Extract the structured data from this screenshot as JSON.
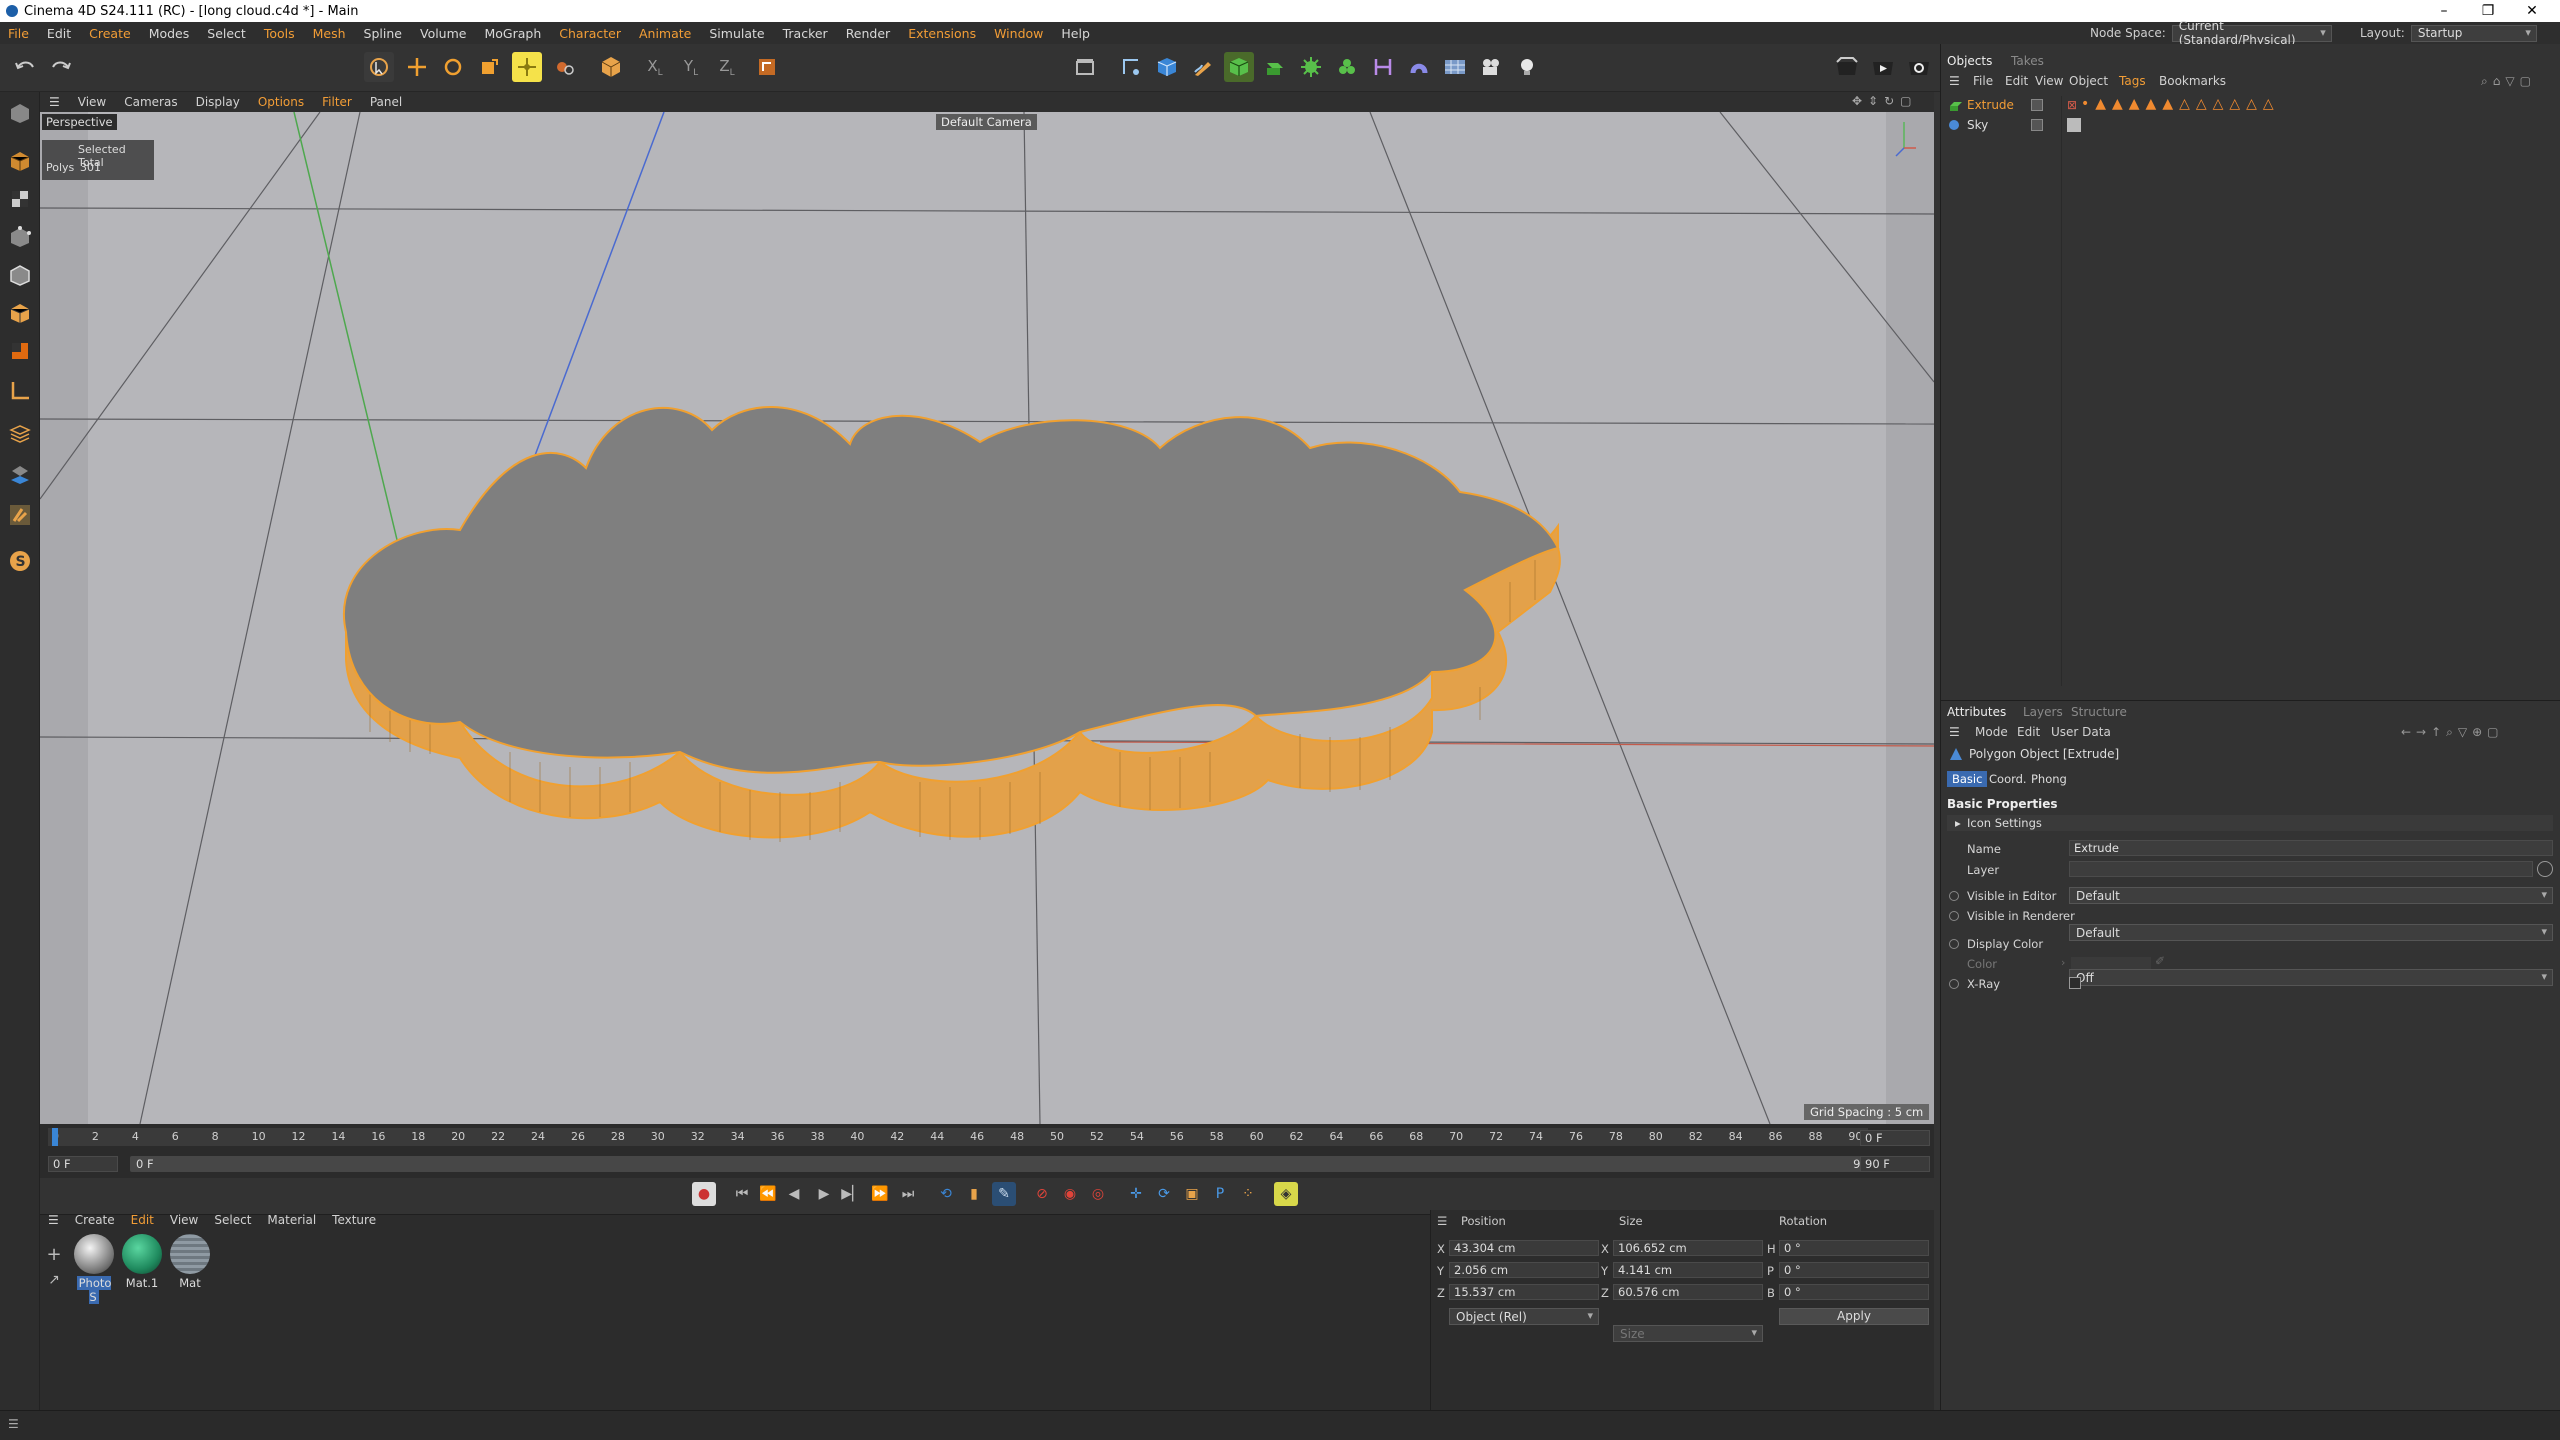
{
  "window": {
    "title": "Cinema 4D S24.111 (RC) - [long cloud.c4d *] - Main",
    "minimize": "–",
    "maximize": "❐",
    "close": "✕"
  },
  "menubar": {
    "items": [
      "File",
      "Edit",
      "Create",
      "Modes",
      "Select",
      "Tools",
      "Mesh",
      "Spline",
      "Volume",
      "MoGraph",
      "Character",
      "Animate",
      "Simulate",
      "Tracker",
      "Render",
      "Extensions",
      "Window",
      "Help"
    ],
    "highlighted": [
      "Character",
      "Animate",
      "Extensions"
    ],
    "node_space_label": "Node Space:",
    "node_space_value": "Current (Standard/Physical)",
    "layout_label": "Layout:",
    "layout_value": "Startup"
  },
  "viewport": {
    "menu": [
      "View",
      "Cameras",
      "Display",
      "Options",
      "Filter",
      "Panel"
    ],
    "menu_highlighted": "Options",
    "view_name": "Perspective",
    "camera": "Default Camera",
    "hud_header": "Selected Total",
    "hud_polys_label": "Polys",
    "hud_polys_value": "301",
    "grid_spacing": "Grid Spacing : 5 cm"
  },
  "timeline": {
    "ticks": [
      "0",
      "2",
      "4",
      "6",
      "8",
      "10",
      "12",
      "14",
      "16",
      "18",
      "20",
      "22",
      "24",
      "26",
      "28",
      "30",
      "32",
      "34",
      "36",
      "38",
      "40",
      "42",
      "44",
      "46",
      "48",
      "50",
      "52",
      "54",
      "56",
      "58",
      "60",
      "62",
      "64",
      "66",
      "68",
      "70",
      "72",
      "74",
      "76",
      "78",
      "80",
      "82",
      "84",
      "86",
      "88",
      "90"
    ],
    "current_frame": "0 F",
    "start_field": "0 F",
    "range_start": "0 F",
    "range_end": "90 F",
    "end_field": "90 F"
  },
  "materials": {
    "menu": [
      "Create",
      "Edit",
      "View",
      "Select",
      "Material",
      "Texture"
    ],
    "menu_highlighted": "Edit",
    "items": [
      {
        "name": "Photo S",
        "color": "#d0d0d0"
      },
      {
        "name": "Mat.1",
        "color": "#1f8a5e"
      },
      {
        "name": "Mat",
        "color": "#8f9aa3"
      }
    ]
  },
  "coordinates": {
    "headers": {
      "position": "Position",
      "size": "Size",
      "rotation": "Rotation"
    },
    "pos": {
      "x": "43.304 cm",
      "y": "2.056 cm",
      "z": "15.537 cm"
    },
    "size": {
      "x": "106.652 cm",
      "y": "4.141 cm",
      "z": "60.576 cm"
    },
    "rot": {
      "h": "0 °",
      "p": "0 °",
      "b": "0 °"
    },
    "axes_pos": [
      "X",
      "Y",
      "Z"
    ],
    "axes_size": [
      "X",
      "Y",
      "Z"
    ],
    "axes_rot": [
      "H",
      "P",
      "B"
    ],
    "mode": "Object (Rel)",
    "size_mode": "Size",
    "apply": "Apply"
  },
  "objects": {
    "tabs": [
      "Objects",
      "Takes"
    ],
    "menu": [
      "File",
      "Edit",
      "View",
      "Object",
      "Tags",
      "Bookmarks"
    ],
    "menu_highlighted": "Tags",
    "rows": [
      {
        "name": "Extrude",
        "selected": true
      },
      {
        "name": "Sky",
        "selected": false
      }
    ]
  },
  "attributes": {
    "tabs": [
      "Attributes",
      "Layers",
      "Structure"
    ],
    "menu": [
      "Mode",
      "Edit",
      "User Data"
    ],
    "object_title": "Polygon Object [Extrude]",
    "subtabs": [
      "Basic",
      "Coord.",
      "Phong"
    ],
    "section": "Basic Properties",
    "icon_settings": "Icon Settings",
    "name_label": "Name",
    "name_value": "Extrude",
    "layer_label": "Layer",
    "layer_value": "",
    "visible_editor_label": "Visible in Editor",
    "visible_editor_value": "Default",
    "visible_renderer_label": "Visible in Renderer",
    "visible_renderer_value": "Default",
    "display_color_label": "Display Color",
    "display_color_value": "Off",
    "color_label": "Color",
    "xray_label": "X-Ray"
  },
  "colors": {
    "accent": "#f29d36",
    "active_tool": "#f5e24a",
    "viewport_bg": "#b5b5b9",
    "cloud_top": "#7d7d7d",
    "cloud_side": "#e3a14a"
  }
}
